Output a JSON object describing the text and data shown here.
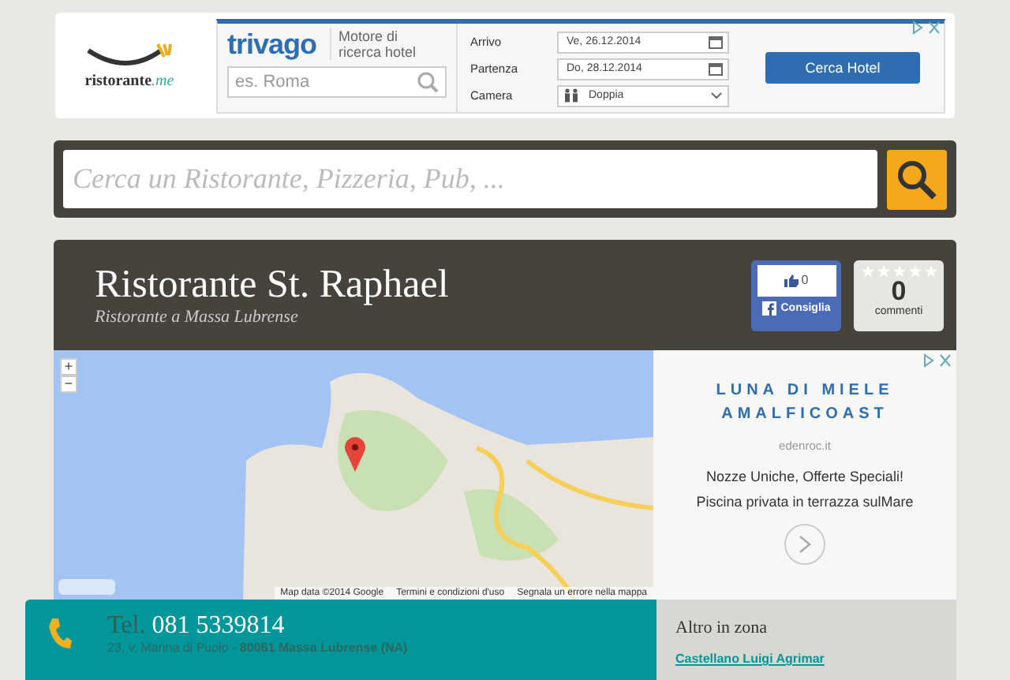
{
  "logo": {
    "text": "ristorante",
    "suffix": ".me"
  },
  "hotel_ad": {
    "brand": "trivago",
    "tagline": "Motore di ricerca hotel",
    "search": {
      "placeholder": "es. Roma"
    },
    "fields": [
      {
        "label": "Arrivo",
        "value": "Ve, 26.12.2014",
        "kind": "date"
      },
      {
        "label": "Partenza",
        "value": "Do, 28.12.2014",
        "kind": "date"
      },
      {
        "label": "Camera",
        "value": "Doppia",
        "kind": "select"
      }
    ],
    "button": "Cerca Hotel"
  },
  "search": {
    "placeholder": "Cerca un Ristorante, Pizzeria, Pub, ..."
  },
  "restaurant": {
    "name": "Ristorante St. Raphael",
    "subtitle": "Ristorante a Massa Lubrense",
    "likes": "0",
    "like_button": "Consiglia",
    "stars": 0,
    "comments_count": "0",
    "comments_label": "commenti"
  },
  "map": {
    "zoom_in": "+",
    "zoom_out": "−",
    "attribution": [
      "Map data ©2014 Google",
      "Termini e condizioni d'uso",
      "Segnala un errore nella mappa"
    ]
  },
  "side_ad": {
    "title": "LUNA DI MIELE AMALFICOAST",
    "domain": "edenroc.it",
    "text": "Nozze Uniche, Offerte Speciali! Piscina privata in terrazza sulMare"
  },
  "contact": {
    "phone_label": "Tel.",
    "phone": "081 5339814",
    "address": "23, v. Marina di Puolo - **80061 Massa Lubrense (NA)**"
  },
  "nearby": {
    "title": "Altro in zona",
    "items": [
      "Castellano Luigi Agrimar"
    ]
  }
}
